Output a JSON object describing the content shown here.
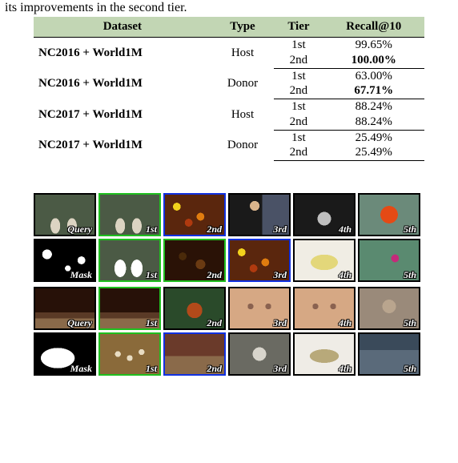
{
  "caption_fragment": "its improvements in the second tier.",
  "table": {
    "headers": [
      "Dataset",
      "Type",
      "Tier",
      "Recall@10"
    ],
    "rows": [
      {
        "dataset": "NC2016 + World1M",
        "type": "Host",
        "tiers": [
          "1st",
          "2nd"
        ],
        "recall": [
          "99.65%",
          "100.00%"
        ],
        "bold_recall": [
          false,
          true
        ]
      },
      {
        "dataset": "NC2016 + World1M",
        "type": "Donor",
        "tiers": [
          "1st",
          "2nd"
        ],
        "recall": [
          "63.00%",
          "67.71%"
        ],
        "bold_recall": [
          false,
          true
        ]
      },
      {
        "dataset": "NC2017 + World1M",
        "type": "Host",
        "tiers": [
          "1st",
          "2nd"
        ],
        "recall": [
          "88.24%",
          "88.24%"
        ],
        "bold_recall": [
          false,
          false
        ]
      },
      {
        "dataset": "NC2017 + World1M",
        "type": "Donor",
        "tiers": [
          "1st",
          "2nd"
        ],
        "recall": [
          "25.49%",
          "25.49%"
        ],
        "bold_recall": [
          false,
          false
        ]
      }
    ]
  },
  "grid": {
    "blocks": [
      {
        "rows": [
          [
            {
              "label": "Query",
              "border": "black",
              "fill": "fill-feet"
            },
            {
              "label": "1st",
              "border": "green",
              "fill": "fill-feet"
            },
            {
              "label": "2nd",
              "border": "blue",
              "fill": "fill-leaves"
            },
            {
              "label": "3rd",
              "border": "black",
              "fill": "fill-speaker"
            },
            {
              "label": "4th",
              "border": "black",
              "fill": "fill-carriage"
            },
            {
              "label": "5th",
              "border": "black",
              "fill": "fill-star"
            }
          ],
          [
            {
              "label": "Mask",
              "border": "black",
              "fill": "fill-mask1"
            },
            {
              "label": "1st",
              "border": "green",
              "fill": "fill-feetwhite"
            },
            {
              "label": "2nd",
              "border": "green",
              "fill": "fill-leavesdark"
            },
            {
              "label": "3rd",
              "border": "blue",
              "fill": "fill-leaves"
            },
            {
              "label": "4th",
              "border": "black",
              "fill": "fill-pasta"
            },
            {
              "label": "5th",
              "border": "black",
              "fill": "fill-diver"
            }
          ]
        ]
      },
      {
        "rows": [
          [
            {
              "label": "Query",
              "border": "black",
              "fill": "fill-theater"
            },
            {
              "label": "1st",
              "border": "green",
              "fill": "fill-theater"
            },
            {
              "label": "2nd",
              "border": "black",
              "fill": "fill-redpanda"
            },
            {
              "label": "3rd",
              "border": "black",
              "fill": "fill-chest"
            },
            {
              "label": "4th",
              "border": "black",
              "fill": "fill-chest"
            },
            {
              "label": "5th",
              "border": "black",
              "fill": "fill-cat"
            }
          ],
          [
            {
              "label": "Mask",
              "border": "black",
              "fill": "fill-mask2"
            },
            {
              "label": "1st",
              "border": "green",
              "fill": "fill-dumplings"
            },
            {
              "label": "2nd",
              "border": "blue",
              "fill": "fill-lobby"
            },
            {
              "label": "3rd",
              "border": "black",
              "fill": "fill-skull"
            },
            {
              "label": "4th",
              "border": "black",
              "fill": "fill-fan"
            },
            {
              "label": "5th",
              "border": "black",
              "fill": "fill-room"
            }
          ]
        ]
      }
    ]
  }
}
